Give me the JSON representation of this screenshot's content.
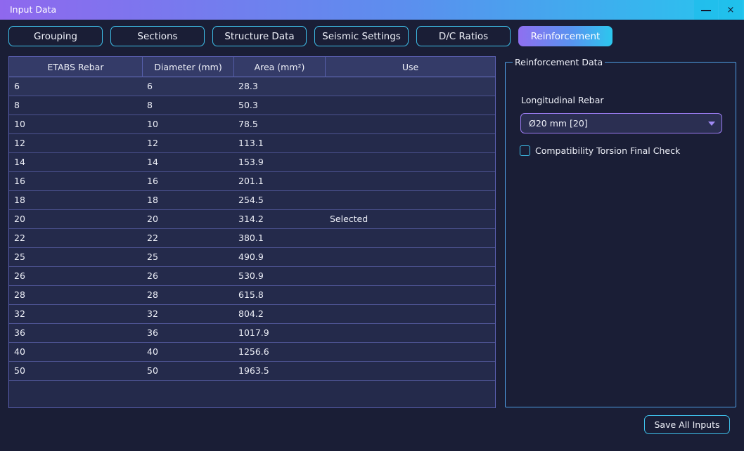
{
  "window": {
    "title": "Input Data",
    "minimize_glyph": "—",
    "close_glyph": "×"
  },
  "tabs": [
    {
      "label": "Grouping",
      "active": false
    },
    {
      "label": "Sections",
      "active": false
    },
    {
      "label": "Structure Data",
      "active": false
    },
    {
      "label": "Seismic Settings",
      "active": false
    },
    {
      "label": "D/C Ratios",
      "active": false
    },
    {
      "label": "Reinforcement",
      "active": true
    }
  ],
  "table": {
    "columns": [
      "ETABS Rebar",
      "Diameter (mm)",
      "Area (mm²)",
      "Use"
    ],
    "rows": [
      [
        "6",
        "6",
        "28.3",
        ""
      ],
      [
        "8",
        "8",
        "50.3",
        ""
      ],
      [
        "10",
        "10",
        "78.5",
        ""
      ],
      [
        "12",
        "12",
        "113.1",
        ""
      ],
      [
        "14",
        "14",
        "153.9",
        ""
      ],
      [
        "16",
        "16",
        "201.1",
        ""
      ],
      [
        "18",
        "18",
        "254.5",
        ""
      ],
      [
        "20",
        "20",
        "314.2",
        "Selected"
      ],
      [
        "22",
        "22",
        "380.1",
        ""
      ],
      [
        "25",
        "25",
        "490.9",
        ""
      ],
      [
        "26",
        "26",
        "530.9",
        ""
      ],
      [
        "28",
        "28",
        "615.8",
        ""
      ],
      [
        "32",
        "32",
        "804.2",
        ""
      ],
      [
        "36",
        "36",
        "1017.9",
        ""
      ],
      [
        "40",
        "40",
        "1256.6",
        ""
      ],
      [
        "50",
        "50",
        "1963.5",
        ""
      ]
    ]
  },
  "reinforcement": {
    "group_title": "Reinforcement Data",
    "longitudinal_label": "Longitudinal Rebar",
    "longitudinal_value": "Ø20 mm  [20]",
    "torsion_check_label": "Compatibility Torsion Final Check",
    "torsion_checked": false
  },
  "footer": {
    "save_label": "Save All Inputs"
  },
  "colors": {
    "background": "#1a1e36",
    "accent_cyan": "#3ec0ea",
    "accent_purple": "#9b7cf2",
    "table_bg": "#242a4b",
    "header_bg": "#343b68"
  }
}
